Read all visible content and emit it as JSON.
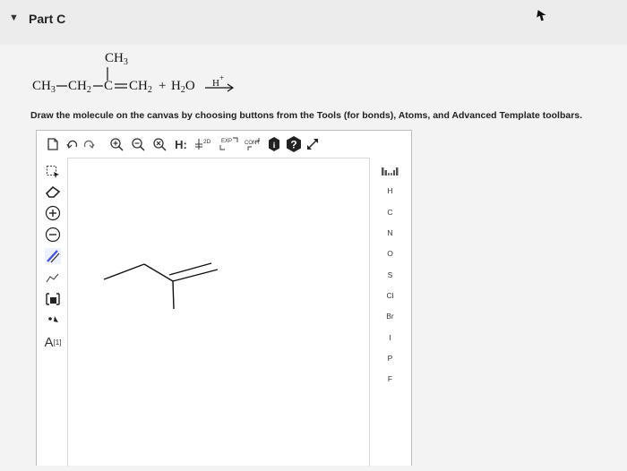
{
  "part": {
    "title": "Part C"
  },
  "reaction": {
    "substituent": "CH",
    "substituent_sub": "3",
    "chain": [
      {
        "text": "CH",
        "sub": "3"
      },
      {
        "text": "CH",
        "sub": "2"
      },
      {
        "text": "C",
        "sub": ""
      },
      {
        "text": "CH",
        "sub": "2"
      }
    ],
    "plus": "+",
    "reagent": {
      "text": "H",
      "sub": "2",
      "tail": "O"
    },
    "catalyst": {
      "text": "H",
      "sup": "+"
    }
  },
  "instruction": "Draw the molecule on the canvas by choosing buttons from the Tools (for bonds), Atoms, and Advanced Template toolbars.",
  "toolbar": {
    "hydrogen_toggle": "H:",
    "label_2d": "2D",
    "label_exp": "EXP",
    "label_cont": "CONT",
    "info_symbol": "i",
    "help_symbol": "?"
  },
  "left_tools": {
    "atom_map_label": "A",
    "atom_map_index": "[1]"
  },
  "atoms": [
    "H",
    "C",
    "N",
    "O",
    "S",
    "Cl",
    "Br",
    "I",
    "P",
    "F"
  ]
}
